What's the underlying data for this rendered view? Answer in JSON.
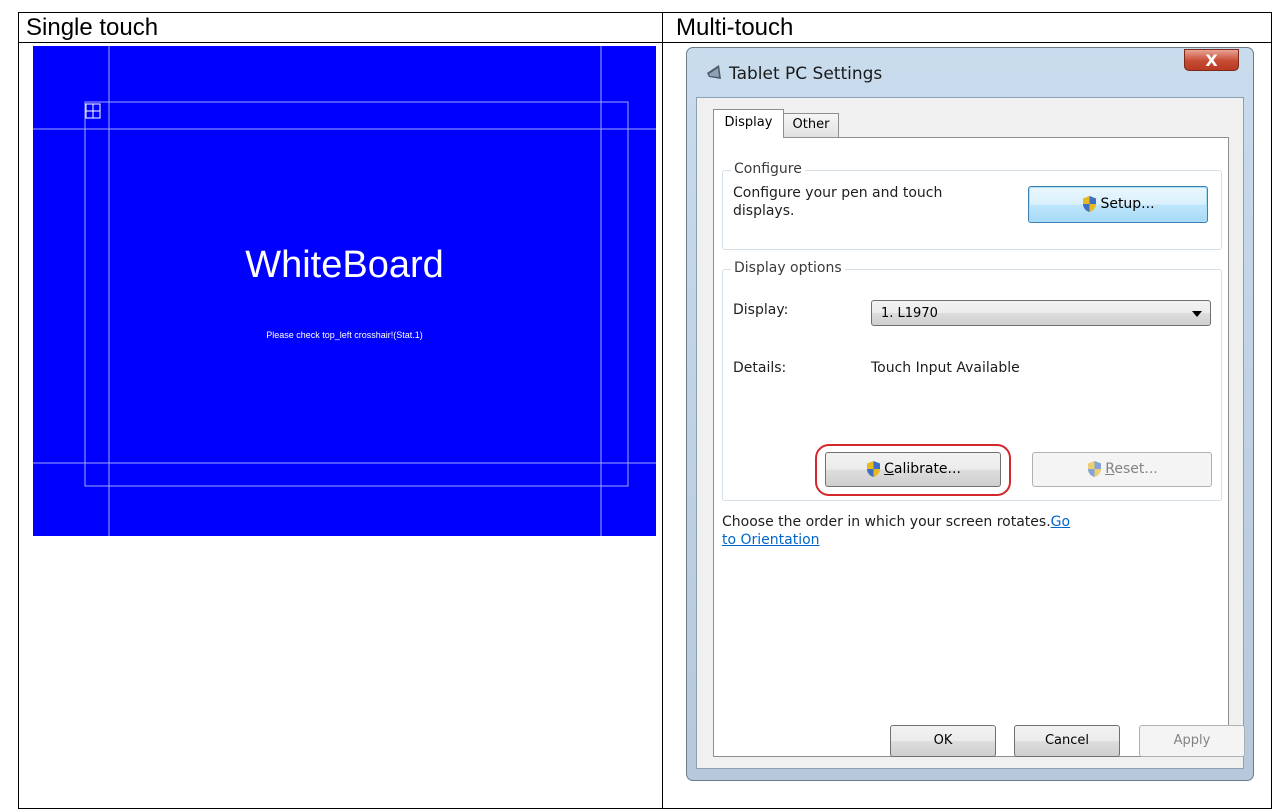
{
  "table": {
    "left_header": "Single touch",
    "right_header": "Multi-touch"
  },
  "whiteboard": {
    "title": "WhiteBoard",
    "message": "Please check top_left crosshair!(Stat.1)",
    "background_color": "#0000ff"
  },
  "window": {
    "title": "Tablet PC Settings",
    "close_label": "X",
    "tabs": [
      {
        "label": "Display",
        "active": true
      },
      {
        "label": "Other",
        "active": false
      }
    ],
    "configure": {
      "group_label": "Configure",
      "description_line1": "Configure your pen and touch",
      "description_line2": "displays.",
      "setup_button": "Setup..."
    },
    "display_options": {
      "group_label": "Display options",
      "display_label": "Display:",
      "display_value": "1. L1970",
      "details_label": "Details:",
      "details_value": "Touch Input Available",
      "calibrate_accel": "C",
      "calibrate_rest": "alibrate...",
      "reset_accel": "R",
      "reset_rest": "eset..."
    },
    "orientation": {
      "text": "Choose the order in which your screen rotates.",
      "link_part1": "Go",
      "link_part2": "to Orientation"
    },
    "footer": {
      "ok": "OK",
      "cancel": "Cancel",
      "apply": "Apply"
    },
    "highlight_color": "#d4262b"
  }
}
